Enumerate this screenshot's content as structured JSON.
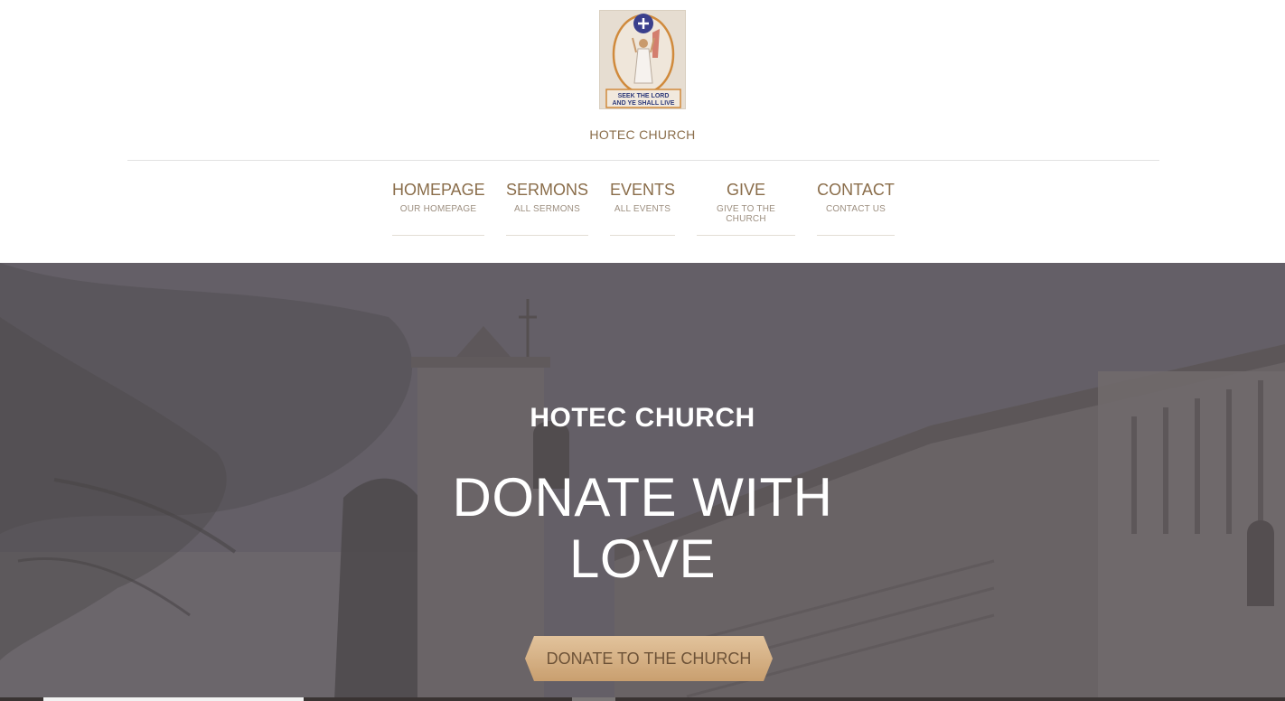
{
  "header": {
    "site_title": "HOTEC CHURCH",
    "logo": {
      "text_line1": "SEEK THE LORD",
      "text_line2": "AND YE SHALL LIVE"
    }
  },
  "nav": {
    "items": [
      {
        "label": "HOMEPAGE",
        "sub": "OUR HOMEPAGE"
      },
      {
        "label": "SERMONS",
        "sub": "ALL SERMONS"
      },
      {
        "label": "EVENTS",
        "sub": "ALL EVENTS"
      },
      {
        "label": "GIVE",
        "sub": "GIVE TO THE CHURCH"
      },
      {
        "label": "CONTACT",
        "sub": "CONTACT US"
      }
    ]
  },
  "hero": {
    "kicker": "HOTEC CHURCH",
    "title_line1": "DONATE WITH",
    "title_line2": "LOVE",
    "button_label": "DONATE TO THE CHURCH"
  },
  "colors": {
    "brand_text": "#8a6d4a",
    "button_gold": "#d4b185",
    "hero_overlay": "#5e5a60"
  }
}
